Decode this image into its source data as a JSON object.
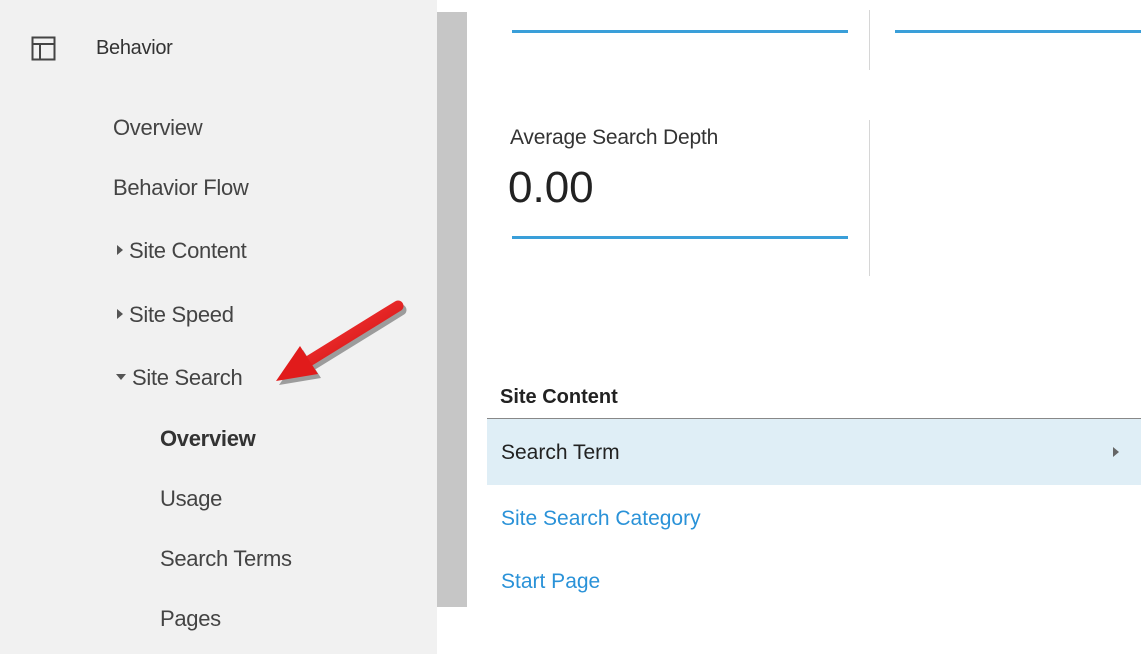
{
  "sidebar": {
    "section_label": "Behavior",
    "items": [
      {
        "label": "Overview"
      },
      {
        "label": "Behavior Flow"
      },
      {
        "label": "Site Content"
      },
      {
        "label": "Site Speed"
      },
      {
        "label": "Site Search"
      }
    ],
    "sub_items": [
      {
        "label": "Overview",
        "active": true
      },
      {
        "label": "Usage"
      },
      {
        "label": "Search Terms"
      },
      {
        "label": "Pages"
      }
    ]
  },
  "metric": {
    "label": "Average Search Depth",
    "value": "0.00"
  },
  "dimension_section": {
    "title": "Site Content",
    "selected": "Search Term",
    "options": [
      "Site Search Category",
      "Start Page"
    ]
  },
  "colors": {
    "accent": "#3a9fd9",
    "link": "#2a92d8",
    "selected_row": "#dfeef6",
    "annotation_arrow": "#e11b1b"
  },
  "icons": {
    "section": "layout-panel-icon",
    "expand": "triangle-right-icon",
    "collapse": "triangle-down-icon",
    "row": "chevron-right-icon",
    "annotation": "red-arrow-icon"
  }
}
